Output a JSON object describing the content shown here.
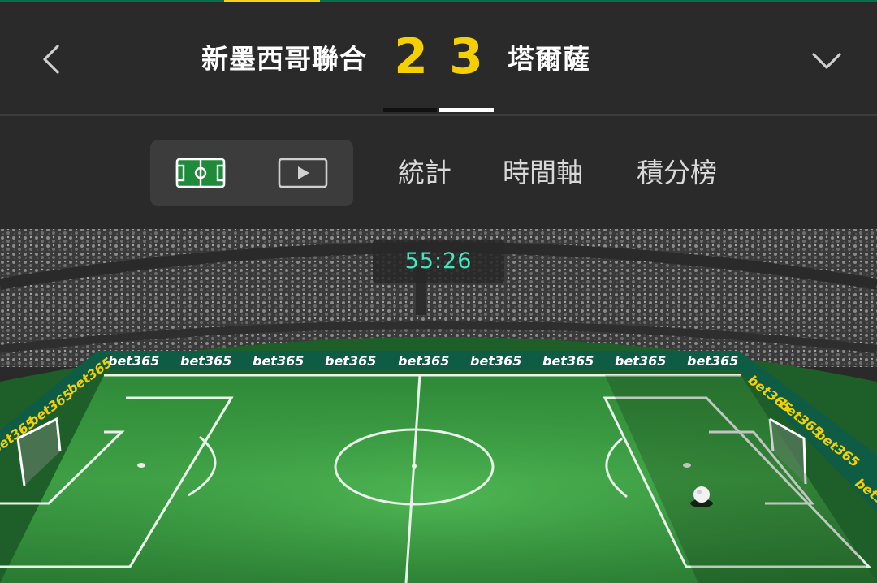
{
  "header": {
    "home_team": "新墨西哥聯合",
    "away_team": "塔爾薩",
    "home_score": "2",
    "away_score": "3",
    "back_icon": "chevron-left-icon",
    "expand_icon": "chevron-down-icon"
  },
  "tabs": {
    "view_pitch_icon": "pitch-icon",
    "view_video_icon": "play-icon",
    "items": [
      {
        "label": "統計"
      },
      {
        "label": "時間軸"
      },
      {
        "label": "積分榜"
      }
    ]
  },
  "match": {
    "clock": "55:26",
    "board_text": "bet365"
  },
  "colors": {
    "accent_green": "#0b6e4f",
    "score_yellow": "#f5d000",
    "clock_teal": "#3ee8c0",
    "board_yellow": "#f5d000"
  }
}
